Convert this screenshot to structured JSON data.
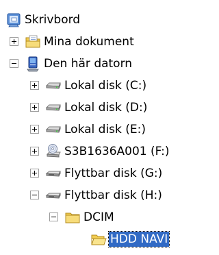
{
  "tree": {
    "desktop": "Skrivbord",
    "my_documents": "Mina dokument",
    "my_computer": "Den här datorn",
    "drive_c": "Lokal disk (C:)",
    "drive_d": "Lokal disk (D:)",
    "drive_e": "Lokal disk (E:)",
    "drive_f": "S3B1636A001 (F:)",
    "drive_g": "Flyttbar disk (G:)",
    "drive_h": "Flyttbar disk (H:)",
    "dcim": "DCIM",
    "hdd_navi": "HDD NAVI",
    "selected_item": "HDD NAVI"
  },
  "colors": {
    "selection_bg": "#316ac5",
    "selection_text": "#ffffff",
    "folder_yellow": "#f2cd52"
  },
  "icons": {
    "desktop": "desktop-icon",
    "my_documents": "documents-folder-icon",
    "my_computer": "computer-icon",
    "hard_drive": "hard-drive-icon",
    "cd_drive": "cd-drive-icon",
    "removable_drive": "removable-drive-icon",
    "folder_closed": "folder-icon",
    "folder_open": "open-folder-icon"
  }
}
